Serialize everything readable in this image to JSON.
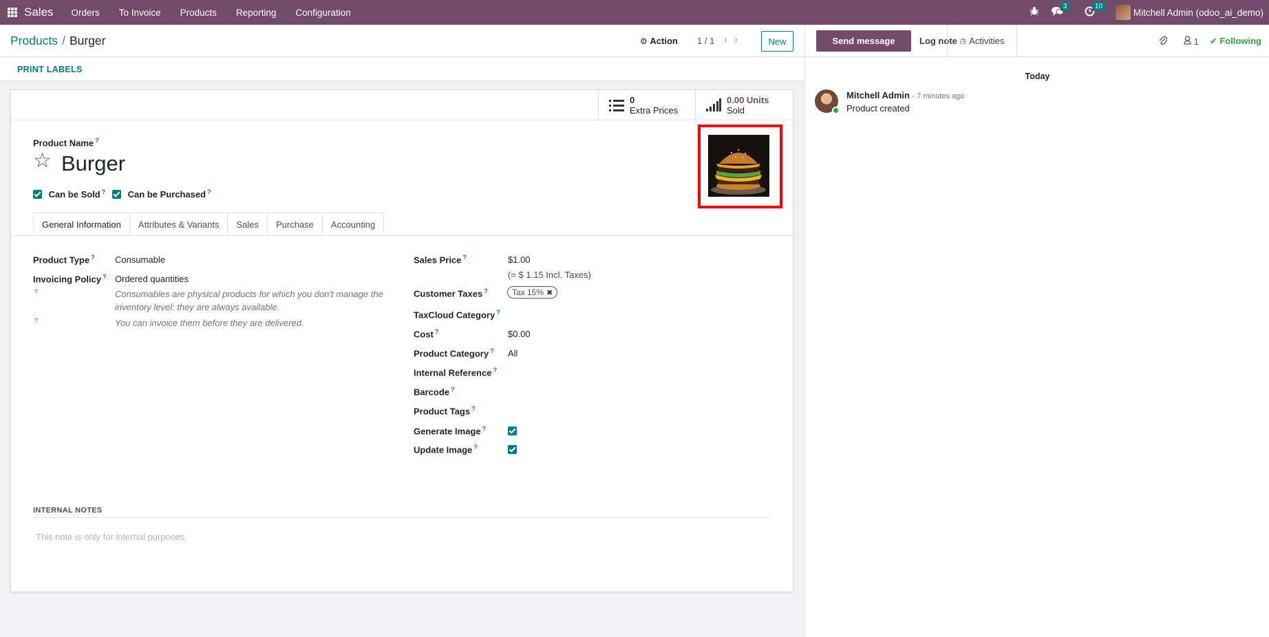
{
  "navbar": {
    "app_name": "Sales",
    "menu": [
      "Orders",
      "To Invoice",
      "Products",
      "Reporting",
      "Configuration"
    ],
    "messages_count": "3",
    "activities_count": "10",
    "user": "Mitchell Admin (odoo_ai_demo)"
  },
  "breadcrumb": {
    "parent": "Products",
    "current": "Burger"
  },
  "control": {
    "action": "Action",
    "pager": "1 / 1",
    "new": "New"
  },
  "status": {
    "print_labels": "PRINT LABELS"
  },
  "smart_buttons": {
    "extra_prices": {
      "value": "0",
      "label": "Extra Prices"
    },
    "sold": {
      "value": "0.00 Units",
      "label": "Sold"
    }
  },
  "product": {
    "name_label": "Product Name",
    "name": "Burger",
    "can_be_sold": "Can be Sold",
    "can_be_purchased": "Can be Purchased"
  },
  "tabs": [
    "General Information",
    "Attributes & Variants",
    "Sales",
    "Purchase",
    "Accounting"
  ],
  "general": {
    "product_type_label": "Product Type",
    "product_type": "Consumable",
    "invoicing_policy_label": "Invoicing Policy",
    "invoicing_policy": "Ordered quantities",
    "help1": "Consumables are physical products for which you don't manage the inventory level: they are always available.",
    "help2": "You can invoice them before they are delivered.",
    "sales_price_label": "Sales Price",
    "sales_price": "$1.00",
    "incl_taxes": "(= $ 1.15 Incl. Taxes)",
    "customer_taxes_label": "Customer Taxes",
    "tax_tag": "Tax 15%",
    "taxcloud_label": "TaxCloud Category",
    "cost_label": "Cost",
    "cost": "$0.00",
    "category_label": "Product Category",
    "category": "All",
    "internal_ref_label": "Internal Reference",
    "barcode_label": "Barcode",
    "tags_label": "Product Tags",
    "generate_image_label": "Generate Image",
    "update_image_label": "Update Image"
  },
  "notes": {
    "label": "INTERNAL NOTES",
    "placeholder": "This note is only for internal purposes."
  },
  "chatter": {
    "send_message": "Send message",
    "log_note": "Log note",
    "activities": "Activities",
    "followers_count": "1",
    "following": "Following",
    "date_separator": "Today",
    "message": {
      "author": "Mitchell Admin",
      "time": "- 7 minutes ago",
      "body": "Product created"
    }
  },
  "colors": {
    "brand": "#714b67",
    "accent": "#017e84",
    "highlight": "#ff0000",
    "following": "#28a745"
  }
}
